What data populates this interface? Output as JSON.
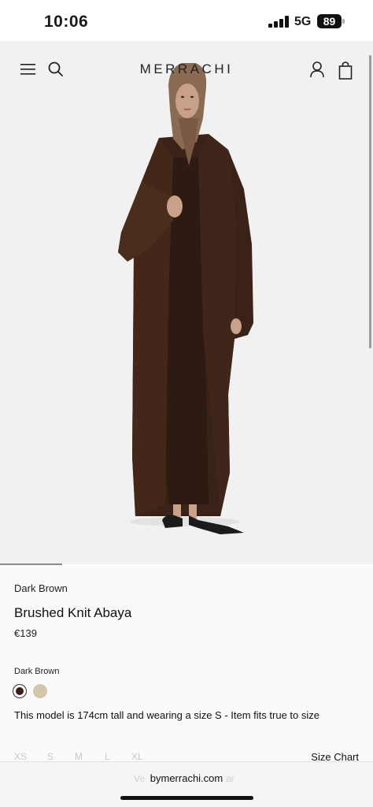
{
  "status_bar": {
    "time": "10:06",
    "network": "5G",
    "battery": "89"
  },
  "header": {
    "brand": "MERRACHI",
    "icons": [
      "menu-icon",
      "search-icon",
      "account-icon",
      "bag-icon"
    ]
  },
  "gallery": {
    "model_colors": {
      "abaya": "#3a2218",
      "hijab": "#8a6a52",
      "skin": "#c9a08a",
      "shoes": "#1b1b1b"
    }
  },
  "product": {
    "color_name": "Dark Brown",
    "title": "Brushed Knit Abaya",
    "price": "€139",
    "swatch_label": "Dark Brown",
    "swatches": [
      {
        "name": "Dark Brown",
        "color": "#3a1d18",
        "selected": true
      },
      {
        "name": "beige",
        "color": "#d2c6ad",
        "selected": false
      }
    ],
    "fit_note": "This model is 174cm tall and wearing a size S - Item fits true to size",
    "sizes": [
      "XS",
      "S",
      "M",
      "L",
      "XL"
    ],
    "size_chart_label": "Size Chart"
  },
  "browser": {
    "url": "bymerrachi.com",
    "ghost_left": "Ve",
    "ghost_right": "ar"
  }
}
